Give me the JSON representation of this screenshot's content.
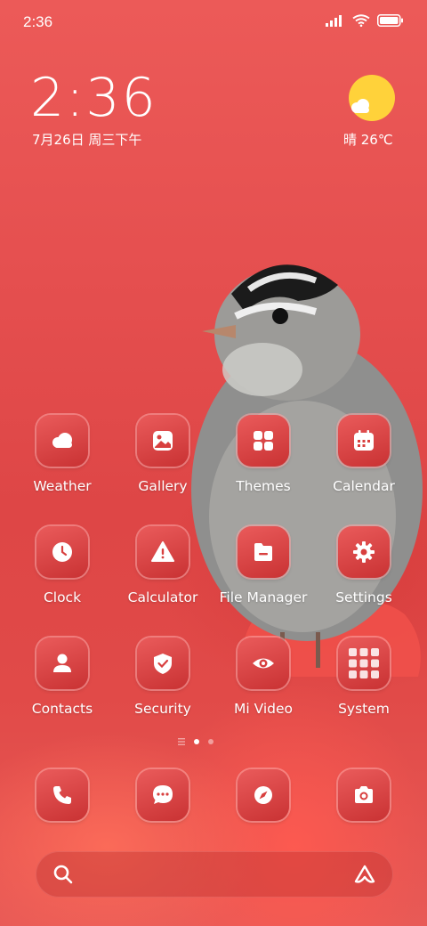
{
  "status_bar": {
    "time": "2:36"
  },
  "clock_widget": {
    "time": "2:36",
    "date": "7月26日 周三下午"
  },
  "weather_widget": {
    "text": "晴 26℃",
    "sun_color": "#ffd23a"
  },
  "apps": {
    "row1": [
      {
        "label": "Weather",
        "icon": "weather-icon"
      },
      {
        "label": "Gallery",
        "icon": "gallery-icon"
      },
      {
        "label": "Themes",
        "icon": "themes-icon"
      },
      {
        "label": "Calendar",
        "icon": "calendar-icon"
      }
    ],
    "row2": [
      {
        "label": "Clock",
        "icon": "clock-icon"
      },
      {
        "label": "Calculator",
        "icon": "calculator-icon"
      },
      {
        "label": "File Manager",
        "icon": "file-manager-icon"
      },
      {
        "label": "Settings",
        "icon": "settings-icon"
      }
    ],
    "row3": [
      {
        "label": "Contacts",
        "icon": "contacts-icon"
      },
      {
        "label": "Security",
        "icon": "security-icon"
      },
      {
        "label": "Mi Video",
        "icon": "video-icon"
      },
      {
        "label": "System",
        "icon": "folder-icon"
      }
    ]
  },
  "dock": [
    {
      "icon": "phone-icon"
    },
    {
      "icon": "messages-icon"
    },
    {
      "icon": "browser-icon"
    },
    {
      "icon": "camera-icon"
    }
  ],
  "page_indicator": {
    "pages": 3,
    "current": 2
  },
  "search_bar": {
    "left_icon": "search-icon",
    "right_icon": "app-vault-icon"
  },
  "colors": {
    "accent": "#e24c4b",
    "icon_bg": "#d8403f"
  }
}
